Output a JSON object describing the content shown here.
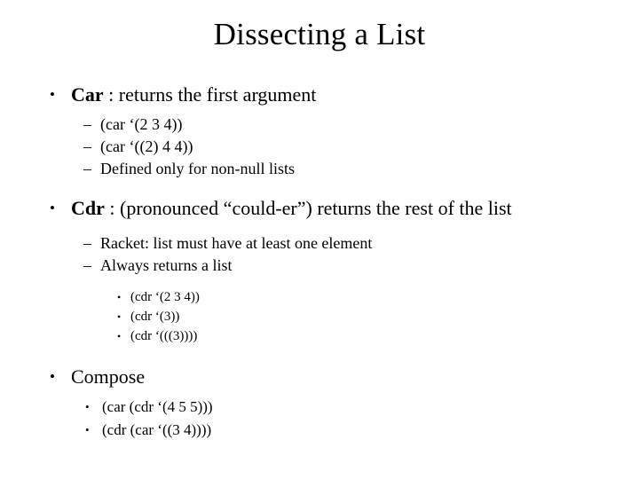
{
  "slide": {
    "title": "Dissecting a List",
    "background_color": "#ffffff",
    "text_color": "#000000",
    "markers": {
      "round_bullet": "•",
      "dash_bullet": "–"
    },
    "content": [
      {
        "level": 1,
        "marker": "round",
        "keyword": "Car",
        "text": " : returns the first argument"
      },
      {
        "level": 2,
        "marker": "dash",
        "text": "(car ‘(2 3 4))"
      },
      {
        "level": 2,
        "marker": "dash",
        "text": "(car ‘((2) 4 4))"
      },
      {
        "level": 2,
        "marker": "dash",
        "text": "Defined only for non-null lists"
      },
      {
        "level": 1,
        "marker": "round",
        "keyword": "Cdr",
        "text": " : (pronounced “could-er”) returns the rest of the list"
      },
      {
        "level": 2,
        "marker": "dash",
        "text": "Racket:  list must have at least one element"
      },
      {
        "level": 2,
        "marker": "dash",
        "text": "Always returns a list"
      },
      {
        "level": 3,
        "marker": "round",
        "text": "(cdr ‘(2 3 4))"
      },
      {
        "level": 3,
        "marker": "round",
        "text": "(cdr ‘(3))"
      },
      {
        "level": 3,
        "marker": "round",
        "text": "(cdr ‘(((3))))"
      },
      {
        "level": 1,
        "marker": "round",
        "text": "Compose"
      },
      {
        "level": 2,
        "marker": "round",
        "text": "(car (cdr ‘(4 5 5)))"
      },
      {
        "level": 2,
        "marker": "round",
        "text": "(cdr (car ‘((3 4))))"
      }
    ]
  }
}
